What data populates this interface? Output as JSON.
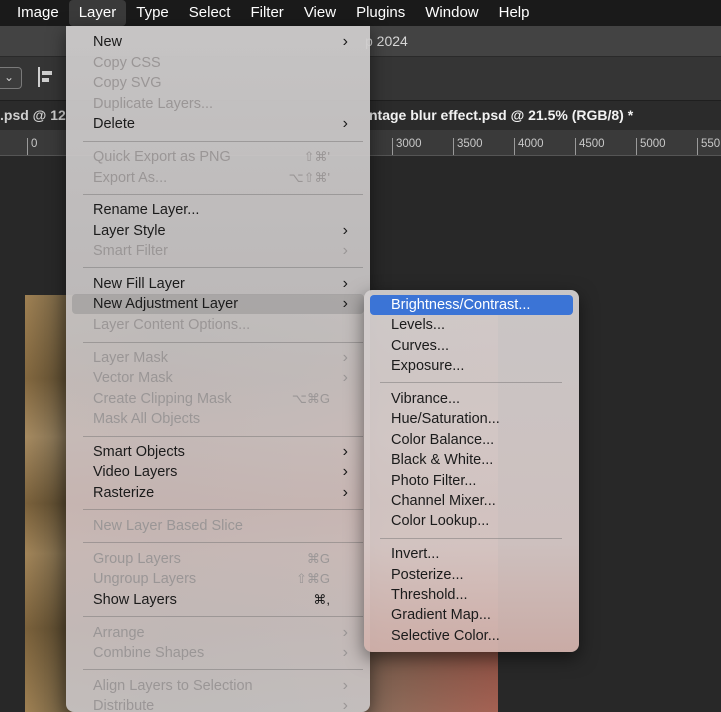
{
  "menubar": [
    "Image",
    "Layer",
    "Type",
    "Select",
    "Filter",
    "View",
    "Plugins",
    "Window",
    "Help"
  ],
  "window_title": "p 2024",
  "tabs": {
    "left": ".psd @ 12",
    "right": "ntage blur effect.psd @ 21.5% (RGB/8) *"
  },
  "ruler": {
    "left_tick": "0",
    "ticks": [
      "3000",
      "3500",
      "4000",
      "4500",
      "5000",
      "550"
    ]
  },
  "layer_menu": {
    "items": [
      {
        "label": "New",
        "shortcut": "",
        "submenu": true,
        "disabled": false
      },
      {
        "label": "Copy CSS",
        "shortcut": "",
        "submenu": false,
        "disabled": true
      },
      {
        "label": "Copy SVG",
        "shortcut": "",
        "submenu": false,
        "disabled": true
      },
      {
        "label": "Duplicate Layers...",
        "shortcut": "",
        "submenu": false,
        "disabled": true
      },
      {
        "label": "Delete",
        "shortcut": "",
        "submenu": true,
        "disabled": false
      },
      {
        "label": "Quick Export as PNG",
        "shortcut": "⇧⌘'",
        "submenu": false,
        "disabled": true
      },
      {
        "label": "Export As...",
        "shortcut": "⌥⇧⌘'",
        "submenu": false,
        "disabled": true
      },
      {
        "label": "Rename Layer...",
        "shortcut": "",
        "submenu": false,
        "disabled": false
      },
      {
        "label": "Layer Style",
        "shortcut": "",
        "submenu": true,
        "disabled": false
      },
      {
        "label": "Smart Filter",
        "shortcut": "",
        "submenu": true,
        "disabled": true
      },
      {
        "label": "New Fill Layer",
        "shortcut": "",
        "submenu": true,
        "disabled": false
      },
      {
        "label": "New Adjustment Layer",
        "shortcut": "",
        "submenu": true,
        "disabled": false,
        "highlighted": true
      },
      {
        "label": "Layer Content Options...",
        "shortcut": "",
        "submenu": false,
        "disabled": true
      },
      {
        "label": "Layer Mask",
        "shortcut": "",
        "submenu": true,
        "disabled": true
      },
      {
        "label": "Vector Mask",
        "shortcut": "",
        "submenu": true,
        "disabled": true
      },
      {
        "label": "Create Clipping Mask",
        "shortcut": "⌥⌘G",
        "submenu": false,
        "disabled": true
      },
      {
        "label": "Mask All Objects",
        "shortcut": "",
        "submenu": false,
        "disabled": true
      },
      {
        "label": "Smart Objects",
        "shortcut": "",
        "submenu": true,
        "disabled": false
      },
      {
        "label": "Video Layers",
        "shortcut": "",
        "submenu": true,
        "disabled": false
      },
      {
        "label": "Rasterize",
        "shortcut": "",
        "submenu": true,
        "disabled": false
      },
      {
        "label": "New Layer Based Slice",
        "shortcut": "",
        "submenu": false,
        "disabled": true
      },
      {
        "label": "Group Layers",
        "shortcut": "⌘G",
        "submenu": false,
        "disabled": true
      },
      {
        "label": "Ungroup Layers",
        "shortcut": "⇧⌘G",
        "submenu": false,
        "disabled": true
      },
      {
        "label": "Show Layers",
        "shortcut": "⌘,",
        "submenu": false,
        "disabled": false
      },
      {
        "label": "Arrange",
        "shortcut": "",
        "submenu": true,
        "disabled": true
      },
      {
        "label": "Combine Shapes",
        "shortcut": "",
        "submenu": true,
        "disabled": true
      },
      {
        "label": "Align Layers to Selection",
        "shortcut": "",
        "submenu": true,
        "disabled": true
      },
      {
        "label": "Distribute",
        "shortcut": "",
        "submenu": true,
        "disabled": true
      }
    ]
  },
  "adjustment_submenu": {
    "items": [
      {
        "label": "Brightness/Contrast...",
        "selected": true
      },
      {
        "label": "Levels..."
      },
      {
        "label": "Curves..."
      },
      {
        "label": "Exposure..."
      },
      {
        "label": "Vibrance..."
      },
      {
        "label": "Hue/Saturation..."
      },
      {
        "label": "Color Balance..."
      },
      {
        "label": "Black & White..."
      },
      {
        "label": "Photo Filter..."
      },
      {
        "label": "Channel Mixer..."
      },
      {
        "label": "Color Lookup..."
      },
      {
        "label": "Invert..."
      },
      {
        "label": "Posterize..."
      },
      {
        "label": "Threshold..."
      },
      {
        "label": "Gradient Map..."
      },
      {
        "label": "Selective Color..."
      }
    ]
  },
  "colors": {
    "selection_accent": "#3b74d6",
    "menubar_bg": "#1a1a1a"
  }
}
